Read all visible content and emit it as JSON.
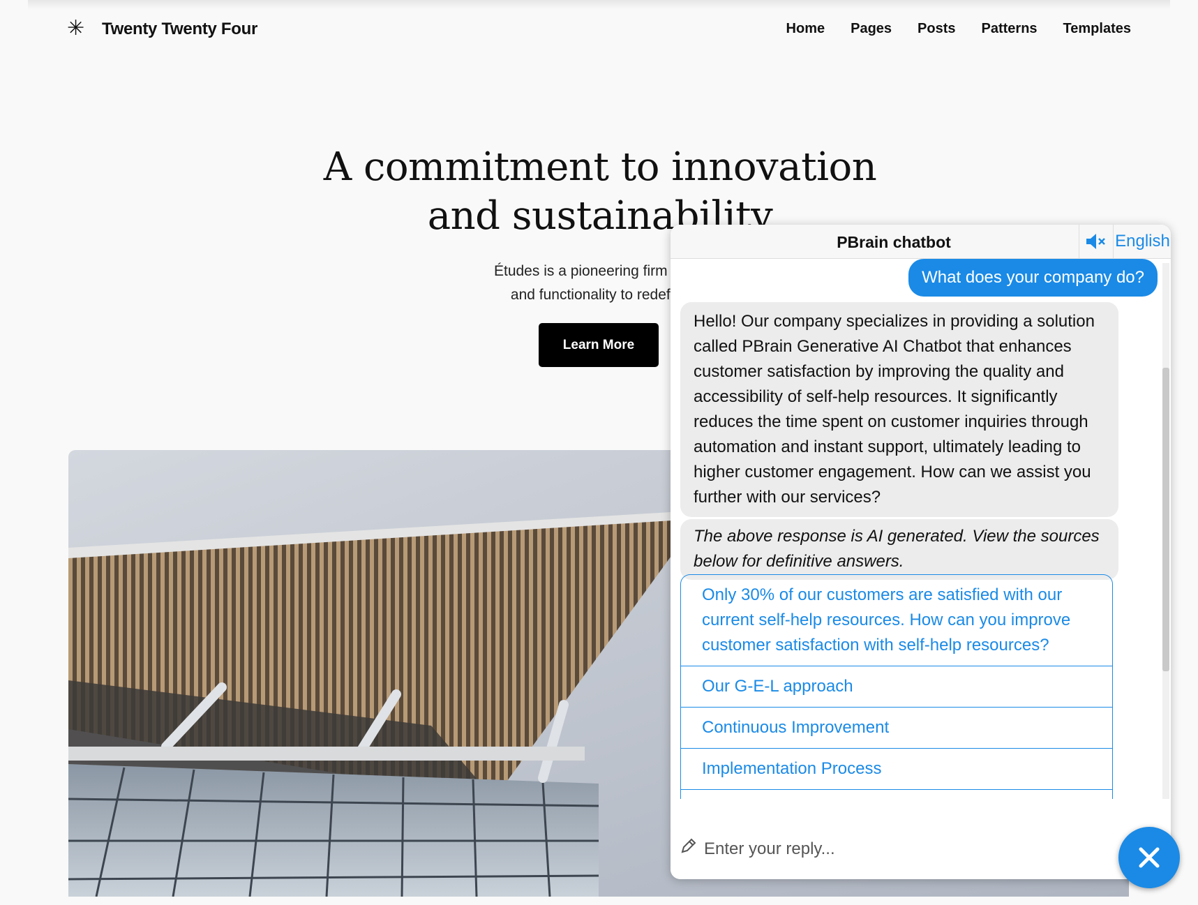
{
  "site": {
    "title": "Twenty Twenty Four",
    "nav": [
      "Home",
      "Pages",
      "Posts",
      "Patterns",
      "Templates"
    ]
  },
  "hero": {
    "title_line1": "A commitment to innovation",
    "title_line2": "and sustainability",
    "subtitle_line1": "Études is a pioneering firm that seamless",
    "subtitle_line2": "and functionality to redefine architec",
    "button_label": "Learn More"
  },
  "chatbot": {
    "title": "PBrain chatbot",
    "mute_icon": "speaker-muted-icon",
    "language": "English",
    "user_message": "What does your company do?",
    "bot_message": "Hello! Our company specializes in providing a solution called PBrain Generative AI Chatbot that enhances customer satisfaction by improving the quality and accessibility of self-help resources. It significantly reduces the time spent on customer inquiries through automation and instant support, ultimately leading to higher customer engagement. How can we assist you further with our services?",
    "disclaimer": "The above response is AI generated. View the sources below for definitive answers.",
    "sources": [
      "Only 30% of our customers are satisfied with our current self-help resources. How can you improve customer satisfaction with self-help resources?",
      "Our G-E-L approach",
      "Continuous Improvement",
      "Implementation Process"
    ],
    "input_placeholder": "Enter your reply...",
    "accent_color": "#1a8ae6"
  }
}
